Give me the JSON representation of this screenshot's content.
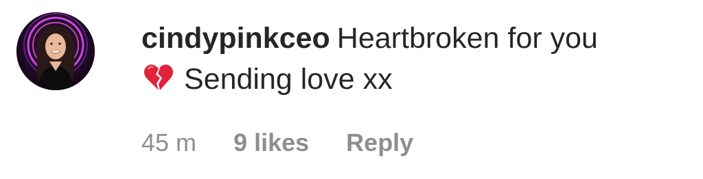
{
  "comment": {
    "username": "cindypinkceo",
    "text_line1": "Heartbroken for you",
    "emoji": "broken-heart-icon",
    "text_line2": "Sending love xx",
    "time": "45 m",
    "likes": "9 likes",
    "reply_label": "Reply"
  },
  "colors": {
    "text": "#262626",
    "meta": "#8e8e8e",
    "heart": "#e0243a",
    "avatar_glow": "#e44cff"
  }
}
